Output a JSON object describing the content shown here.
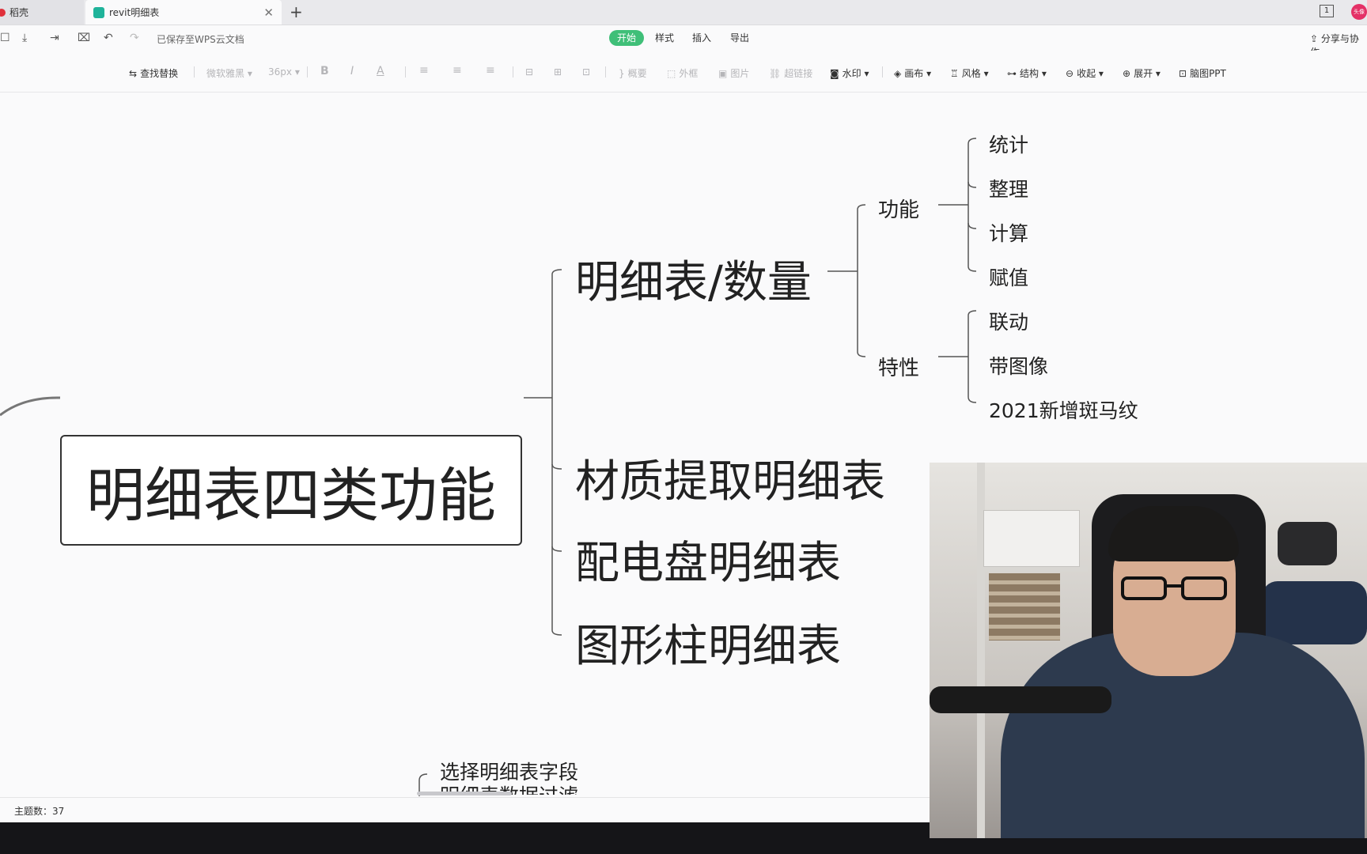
{
  "tabs": [
    {
      "label": "稻壳",
      "icon": "docer-icon"
    },
    {
      "label": "revit明细表",
      "icon": "mindmap-doc-icon",
      "active": true
    }
  ],
  "header": {
    "saved_status": "已保存至WPS云文档",
    "menus": [
      "开始",
      "样式",
      "插入",
      "导出"
    ],
    "active_menu": "开始",
    "share": "分享与协作",
    "window_badge": "1",
    "avatar_text": "头像"
  },
  "toolbar": {
    "find_replace": "查找替换",
    "font": "微软雅黑",
    "font_size": "36px",
    "bold": "B",
    "italic": "I",
    "font_color": "A",
    "summary": "概要",
    "frame": "外框",
    "image": "图片",
    "hyperlink": "超链接",
    "watermark": "水印",
    "canvas": "画布",
    "style": "风格",
    "structure": "结构",
    "collapse": "收起",
    "expand": "展开",
    "mindmap_ppt": "脑图PPT"
  },
  "mindmap": {
    "root": "明细表四类功能",
    "branches": [
      {
        "label": "明细表/数量",
        "children": [
          {
            "label": "功能",
            "children": [
              "统计",
              "整理",
              "计算",
              "赋值"
            ]
          },
          {
            "label": "特性",
            "children": [
              "联动",
              "带图像",
              "2021新增斑马纹"
            ]
          }
        ]
      },
      {
        "label": "材质提取明细表"
      },
      {
        "label": "配电盘明细表"
      },
      {
        "label": "图形柱明细表"
      }
    ],
    "lower_topics": [
      "选择明细表字段",
      "明细表数据过滤"
    ]
  },
  "status": {
    "topic_count": "主题数：37"
  },
  "colors": {
    "accent": "#3fbf78",
    "line": "#555555",
    "taskbar": "#151518"
  }
}
